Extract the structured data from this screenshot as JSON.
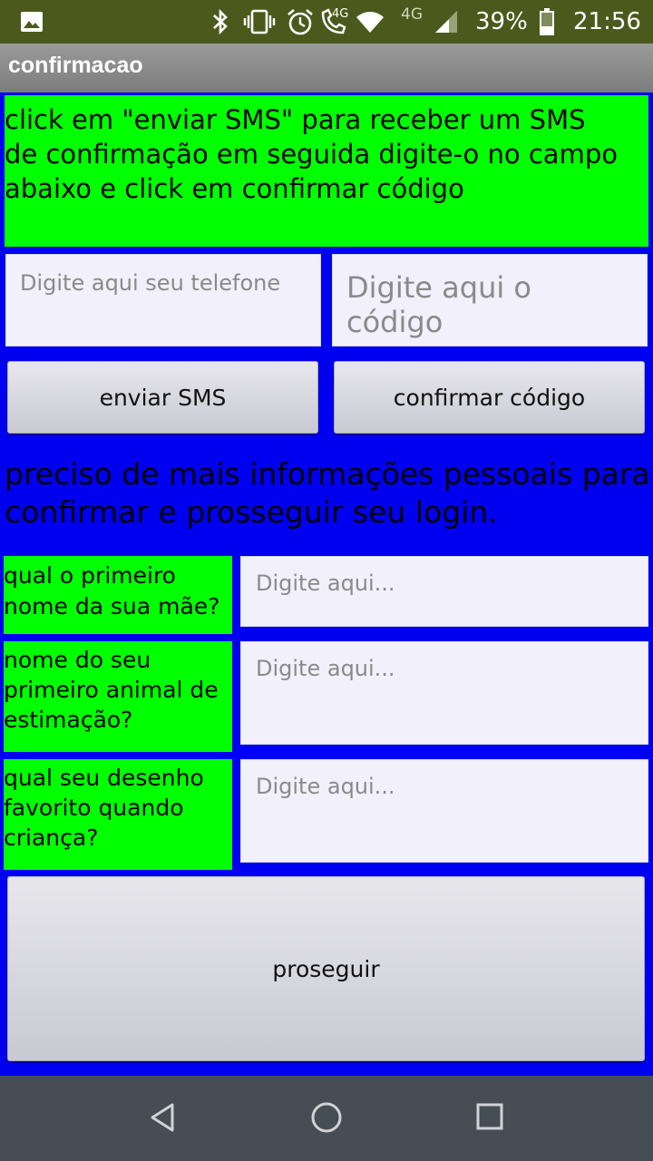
{
  "status_bar": {
    "battery_percent": "39%",
    "time": "21:56",
    "network_label": "4G",
    "call_label": "4G",
    "icons": [
      "image-icon",
      "bluetooth-icon",
      "vibrate-icon",
      "alarm-icon",
      "volte-call-icon",
      "wifi-icon",
      "signal-icon",
      "battery-icon"
    ]
  },
  "app_bar": {
    "title": "confirmacao"
  },
  "instructions": {
    "line1": "click em \"enviar SMS\" para receber um SMS",
    "line2": "de confirmação em seguida digite-o no campo",
    "line3": "abaixo e click em confirmar código"
  },
  "phone_input": {
    "placeholder": "Digite aqui seu telefone",
    "value": ""
  },
  "code_input": {
    "placeholder": "Digite aqui o código",
    "value": ""
  },
  "buttons": {
    "send_sms": "enviar SMS",
    "confirm_code": "confirmar código",
    "proceed": "proseguir"
  },
  "info_message": {
    "line1": "preciso de mais informações pessoais para",
    "line2": "confirmar e prosseguir seu login."
  },
  "questions": [
    {
      "line1": "qual o primeiro",
      "line2": "nome da sua mãe?",
      "line3": "",
      "placeholder": "Digite aqui..."
    },
    {
      "line1": "nome do seu",
      "line2": "primeiro animal de",
      "line3": "estimação?",
      "placeholder": "Digite aqui..."
    },
    {
      "line1": "qual seu desenho",
      "line2": "favorito quando",
      "line3": "criança?",
      "placeholder": "Digite aqui..."
    }
  ],
  "colors": {
    "background": "#0000f0",
    "label_background": "#00ff00",
    "status_bar": "#4b5a1c",
    "nav_bar": "#464d55"
  },
  "nav_bar": {
    "icons": [
      "back-icon",
      "home-icon",
      "recents-icon"
    ]
  }
}
